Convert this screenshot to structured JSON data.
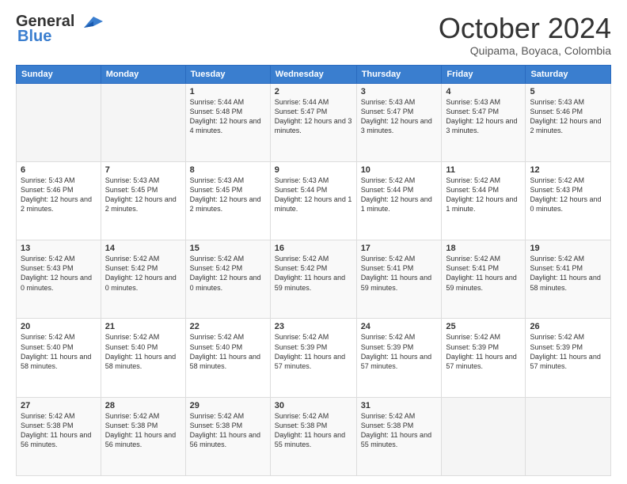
{
  "logo": {
    "line1": "General",
    "line2": "Blue"
  },
  "header": {
    "month": "October 2024",
    "location": "Quipama, Boyaca, Colombia"
  },
  "days_of_week": [
    "Sunday",
    "Monday",
    "Tuesday",
    "Wednesday",
    "Thursday",
    "Friday",
    "Saturday"
  ],
  "weeks": [
    [
      {
        "day": "",
        "sunrise": "",
        "sunset": "",
        "daylight": ""
      },
      {
        "day": "",
        "sunrise": "",
        "sunset": "",
        "daylight": ""
      },
      {
        "day": "1",
        "sunrise": "Sunrise: 5:44 AM",
        "sunset": "Sunset: 5:48 PM",
        "daylight": "Daylight: 12 hours and 4 minutes."
      },
      {
        "day": "2",
        "sunrise": "Sunrise: 5:44 AM",
        "sunset": "Sunset: 5:47 PM",
        "daylight": "Daylight: 12 hours and 3 minutes."
      },
      {
        "day": "3",
        "sunrise": "Sunrise: 5:43 AM",
        "sunset": "Sunset: 5:47 PM",
        "daylight": "Daylight: 12 hours and 3 minutes."
      },
      {
        "day": "4",
        "sunrise": "Sunrise: 5:43 AM",
        "sunset": "Sunset: 5:47 PM",
        "daylight": "Daylight: 12 hours and 3 minutes."
      },
      {
        "day": "5",
        "sunrise": "Sunrise: 5:43 AM",
        "sunset": "Sunset: 5:46 PM",
        "daylight": "Daylight: 12 hours and 2 minutes."
      }
    ],
    [
      {
        "day": "6",
        "sunrise": "Sunrise: 5:43 AM",
        "sunset": "Sunset: 5:46 PM",
        "daylight": "Daylight: 12 hours and 2 minutes."
      },
      {
        "day": "7",
        "sunrise": "Sunrise: 5:43 AM",
        "sunset": "Sunset: 5:45 PM",
        "daylight": "Daylight: 12 hours and 2 minutes."
      },
      {
        "day": "8",
        "sunrise": "Sunrise: 5:43 AM",
        "sunset": "Sunset: 5:45 PM",
        "daylight": "Daylight: 12 hours and 2 minutes."
      },
      {
        "day": "9",
        "sunrise": "Sunrise: 5:43 AM",
        "sunset": "Sunset: 5:44 PM",
        "daylight": "Daylight: 12 hours and 1 minute."
      },
      {
        "day": "10",
        "sunrise": "Sunrise: 5:42 AM",
        "sunset": "Sunset: 5:44 PM",
        "daylight": "Daylight: 12 hours and 1 minute."
      },
      {
        "day": "11",
        "sunrise": "Sunrise: 5:42 AM",
        "sunset": "Sunset: 5:44 PM",
        "daylight": "Daylight: 12 hours and 1 minute."
      },
      {
        "day": "12",
        "sunrise": "Sunrise: 5:42 AM",
        "sunset": "Sunset: 5:43 PM",
        "daylight": "Daylight: 12 hours and 0 minutes."
      }
    ],
    [
      {
        "day": "13",
        "sunrise": "Sunrise: 5:42 AM",
        "sunset": "Sunset: 5:43 PM",
        "daylight": "Daylight: 12 hours and 0 minutes."
      },
      {
        "day": "14",
        "sunrise": "Sunrise: 5:42 AM",
        "sunset": "Sunset: 5:42 PM",
        "daylight": "Daylight: 12 hours and 0 minutes."
      },
      {
        "day": "15",
        "sunrise": "Sunrise: 5:42 AM",
        "sunset": "Sunset: 5:42 PM",
        "daylight": "Daylight: 12 hours and 0 minutes."
      },
      {
        "day": "16",
        "sunrise": "Sunrise: 5:42 AM",
        "sunset": "Sunset: 5:42 PM",
        "daylight": "Daylight: 11 hours and 59 minutes."
      },
      {
        "day": "17",
        "sunrise": "Sunrise: 5:42 AM",
        "sunset": "Sunset: 5:41 PM",
        "daylight": "Daylight: 11 hours and 59 minutes."
      },
      {
        "day": "18",
        "sunrise": "Sunrise: 5:42 AM",
        "sunset": "Sunset: 5:41 PM",
        "daylight": "Daylight: 11 hours and 59 minutes."
      },
      {
        "day": "19",
        "sunrise": "Sunrise: 5:42 AM",
        "sunset": "Sunset: 5:41 PM",
        "daylight": "Daylight: 11 hours and 58 minutes."
      }
    ],
    [
      {
        "day": "20",
        "sunrise": "Sunrise: 5:42 AM",
        "sunset": "Sunset: 5:40 PM",
        "daylight": "Daylight: 11 hours and 58 minutes."
      },
      {
        "day": "21",
        "sunrise": "Sunrise: 5:42 AM",
        "sunset": "Sunset: 5:40 PM",
        "daylight": "Daylight: 11 hours and 58 minutes."
      },
      {
        "day": "22",
        "sunrise": "Sunrise: 5:42 AM",
        "sunset": "Sunset: 5:40 PM",
        "daylight": "Daylight: 11 hours and 58 minutes."
      },
      {
        "day": "23",
        "sunrise": "Sunrise: 5:42 AM",
        "sunset": "Sunset: 5:39 PM",
        "daylight": "Daylight: 11 hours and 57 minutes."
      },
      {
        "day": "24",
        "sunrise": "Sunrise: 5:42 AM",
        "sunset": "Sunset: 5:39 PM",
        "daylight": "Daylight: 11 hours and 57 minutes."
      },
      {
        "day": "25",
        "sunrise": "Sunrise: 5:42 AM",
        "sunset": "Sunset: 5:39 PM",
        "daylight": "Daylight: 11 hours and 57 minutes."
      },
      {
        "day": "26",
        "sunrise": "Sunrise: 5:42 AM",
        "sunset": "Sunset: 5:39 PM",
        "daylight": "Daylight: 11 hours and 57 minutes."
      }
    ],
    [
      {
        "day": "27",
        "sunrise": "Sunrise: 5:42 AM",
        "sunset": "Sunset: 5:38 PM",
        "daylight": "Daylight: 11 hours and 56 minutes."
      },
      {
        "day": "28",
        "sunrise": "Sunrise: 5:42 AM",
        "sunset": "Sunset: 5:38 PM",
        "daylight": "Daylight: 11 hours and 56 minutes."
      },
      {
        "day": "29",
        "sunrise": "Sunrise: 5:42 AM",
        "sunset": "Sunset: 5:38 PM",
        "daylight": "Daylight: 11 hours and 56 minutes."
      },
      {
        "day": "30",
        "sunrise": "Sunrise: 5:42 AM",
        "sunset": "Sunset: 5:38 PM",
        "daylight": "Daylight: 11 hours and 55 minutes."
      },
      {
        "day": "31",
        "sunrise": "Sunrise: 5:42 AM",
        "sunset": "Sunset: 5:38 PM",
        "daylight": "Daylight: 11 hours and 55 minutes."
      },
      {
        "day": "",
        "sunrise": "",
        "sunset": "",
        "daylight": ""
      },
      {
        "day": "",
        "sunrise": "",
        "sunset": "",
        "daylight": ""
      }
    ]
  ]
}
